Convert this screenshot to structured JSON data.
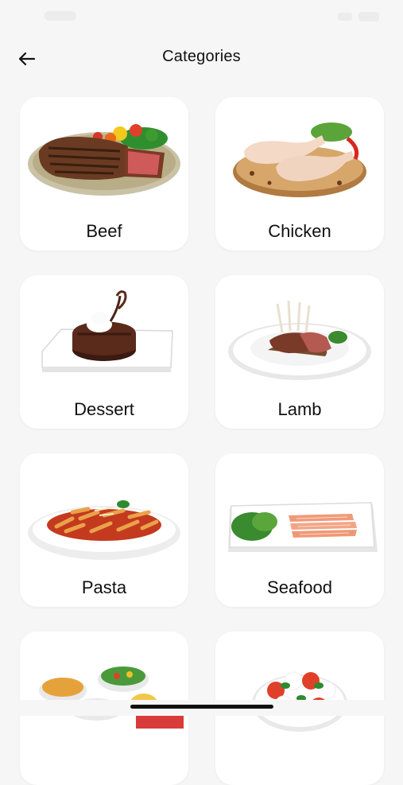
{
  "header": {
    "title": "Categories",
    "back_icon": "arrow-left-icon"
  },
  "categories": [
    {
      "label": "Beef",
      "icon": "beef-steak-image"
    },
    {
      "label": "Chicken",
      "icon": "chicken-legs-image"
    },
    {
      "label": "Dessert",
      "icon": "chocolate-cake-image"
    },
    {
      "label": "Lamb",
      "icon": "lamb-rack-image"
    },
    {
      "label": "Pasta",
      "icon": "penne-pasta-image"
    },
    {
      "label": "Seafood",
      "icon": "salmon-platter-image"
    },
    {
      "label": "",
      "icon": "side-dishes-image"
    },
    {
      "label": "",
      "icon": "caprese-salad-image"
    }
  ],
  "colors": {
    "background": "#f6f6f7",
    "card": "#ffffff",
    "text": "#111111"
  }
}
